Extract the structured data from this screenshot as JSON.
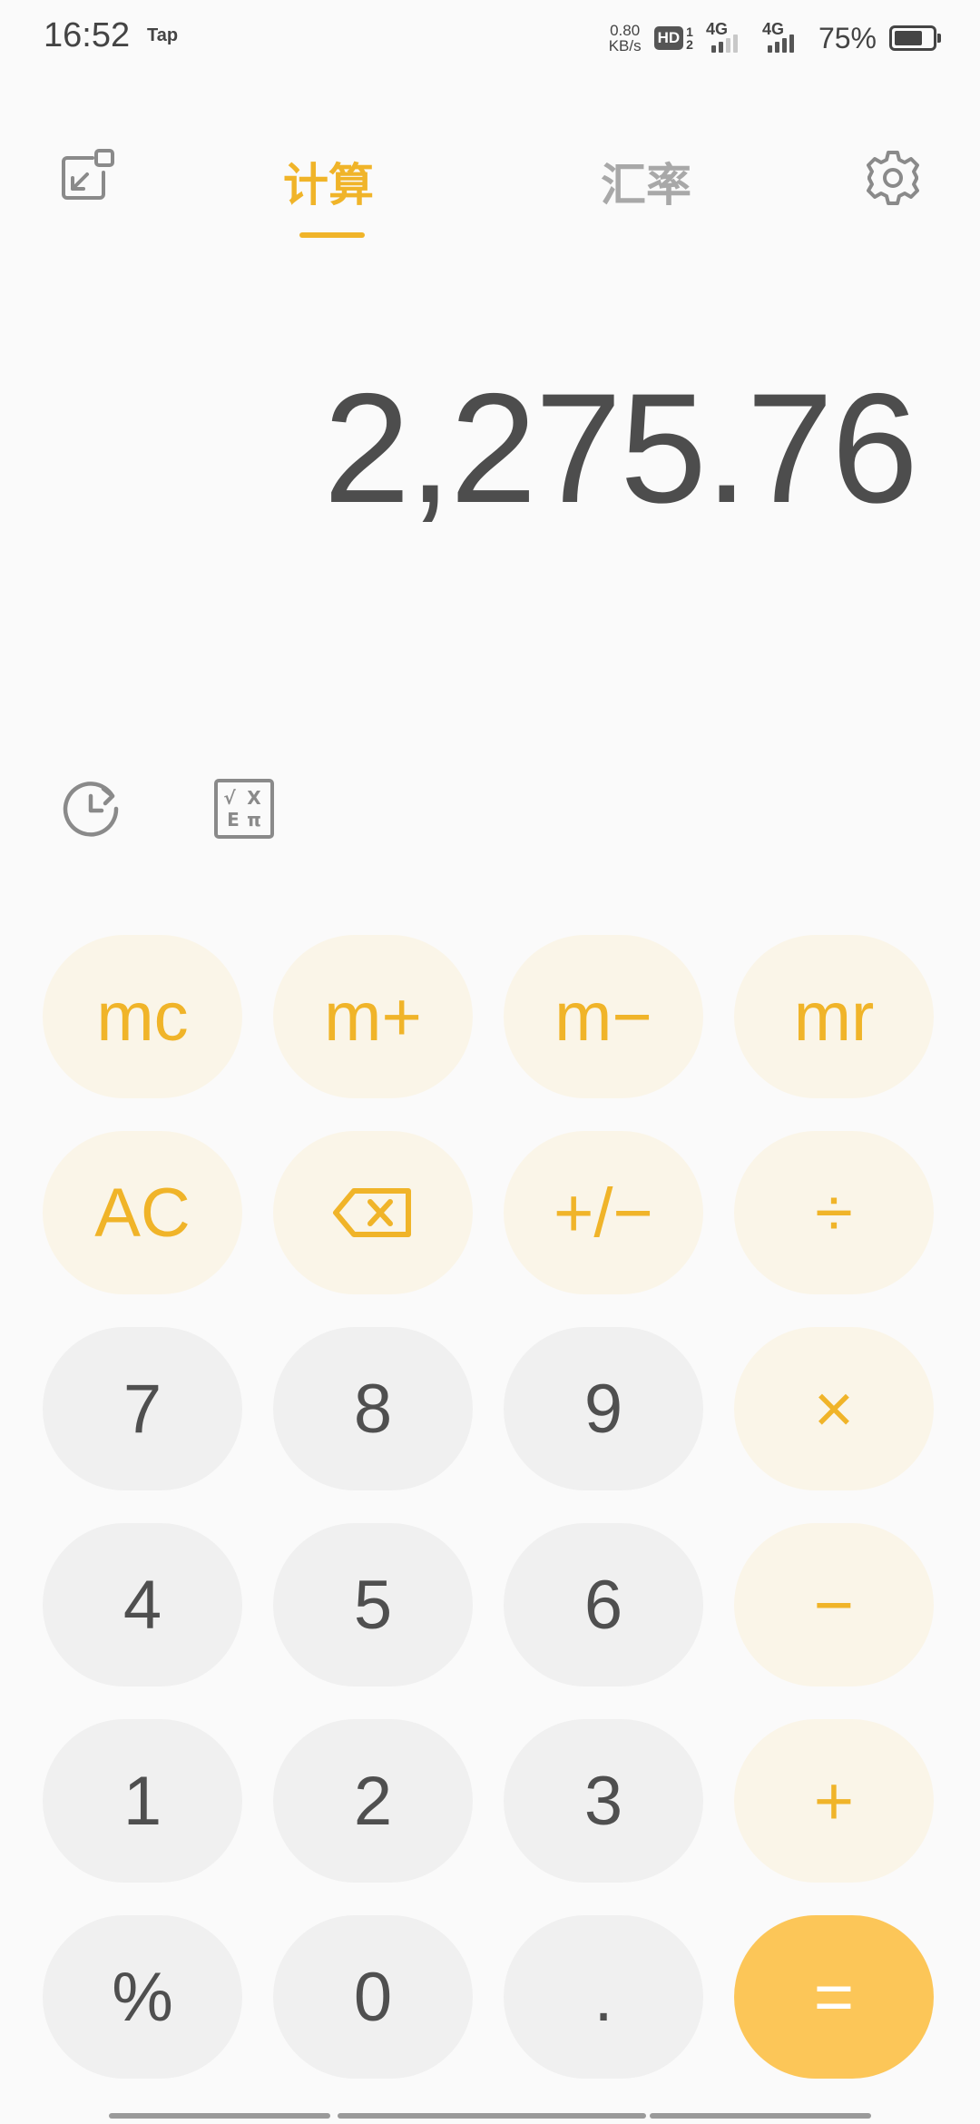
{
  "status_bar": {
    "time": "16:52",
    "tap_label": "Tap",
    "net_speed_value": "0.80",
    "net_speed_unit": "KB/s",
    "hd_label": "HD",
    "hd_sim_top": "1",
    "hd_sim_bottom": "2",
    "sim1_label": "4G",
    "sim2_label": "4G",
    "battery_percent": "75%",
    "battery_level": 0.75
  },
  "header": {
    "tabs": [
      {
        "label": "计算",
        "active": true
      },
      {
        "label": "汇率",
        "active": false
      }
    ],
    "left_icon": "picture-in-picture-icon",
    "right_icon": "settings-gear-icon"
  },
  "display": {
    "value": "2,275.76"
  },
  "tools": {
    "history_icon": "history-clock-icon",
    "scientific_icon": "scientific-functions-icon",
    "scientific_glyphs": [
      "√",
      "X",
      "E",
      "π"
    ]
  },
  "keypad": {
    "rows": [
      [
        "mc",
        "m+",
        "m−",
        "mr"
      ],
      [
        "AC",
        "backspace",
        "+/−",
        "÷"
      ],
      [
        "7",
        "8",
        "9",
        "×"
      ],
      [
        "4",
        "5",
        "6",
        "−"
      ],
      [
        "1",
        "2",
        "3",
        "+"
      ],
      [
        "%",
        "0",
        ".",
        "="
      ]
    ]
  },
  "colors": {
    "accent": "#f0b429",
    "equals_bg": "#fcc658",
    "function_key_bg": "#faf5e8",
    "number_key_bg": "#f0f0f0",
    "background": "#fafafa"
  }
}
